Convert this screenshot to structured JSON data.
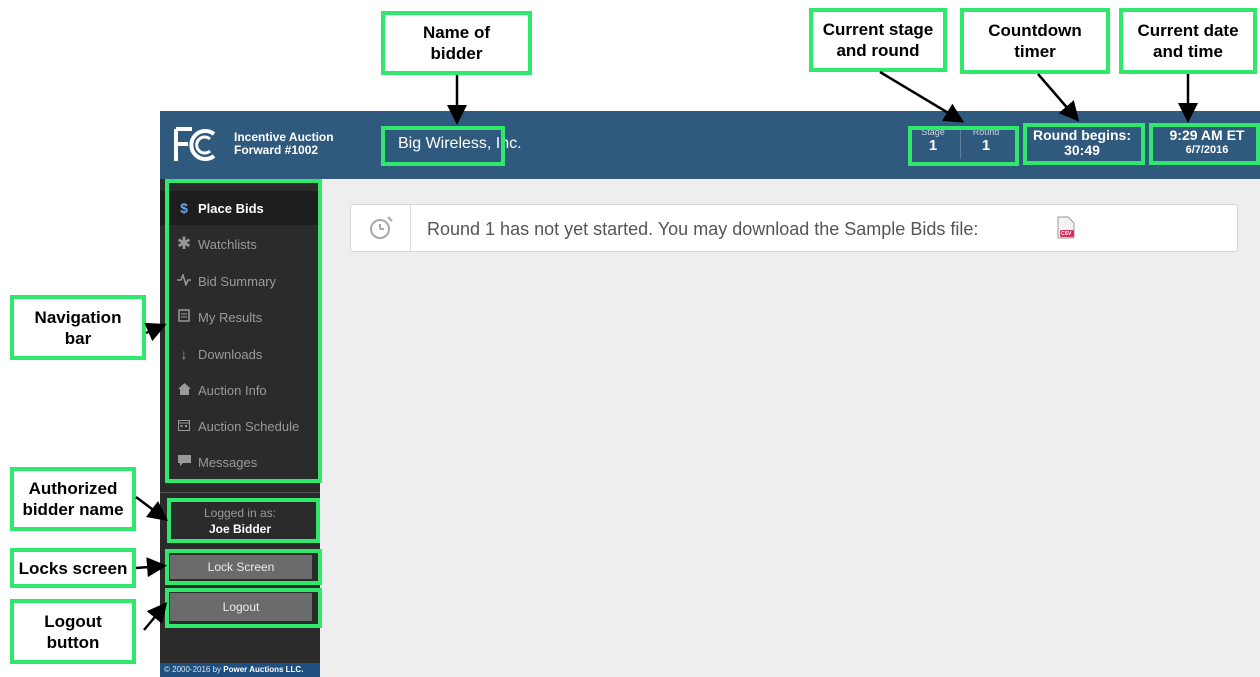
{
  "header": {
    "app_title_line1": "Incentive Auction",
    "app_title_line2": "Forward #1002",
    "bidder_name": "Big Wireless, Inc.",
    "stage_label": "Stage",
    "stage_value": "1",
    "round_label": "Round",
    "round_value": "1",
    "timer_label": "Round begins:",
    "timer_value": "30:49",
    "time": "9:29 AM ET",
    "date": "6/7/2016"
  },
  "sidebar": {
    "items": [
      {
        "label": "Place Bids",
        "icon": "dollar-icon"
      },
      {
        "label": "Watchlists",
        "icon": "asterisk-icon"
      },
      {
        "label": "Bid Summary",
        "icon": "pulse-icon"
      },
      {
        "label": "My Results",
        "icon": "document-icon"
      },
      {
        "label": "Downloads",
        "icon": "download-arrow-icon"
      },
      {
        "label": "Auction Info",
        "icon": "home-icon"
      },
      {
        "label": "Auction Schedule",
        "icon": "calendar-icon"
      },
      {
        "label": "Messages",
        "icon": "message-icon"
      }
    ],
    "logged_in_label": "Logged in as:",
    "logged_in_user": "Joe Bidder",
    "lock_label": "Lock Screen",
    "logout_label": "Logout",
    "copyright_prefix": "© 2000-2016 by ",
    "copyright_company": "Power Auctions LLC."
  },
  "notice": {
    "message": "Round 1 has not yet started.  You may download the Sample Bids file:",
    "file_badge": "CSV"
  },
  "callouts": {
    "name_of_bidder": [
      "Name of",
      "bidder"
    ],
    "stage_round": [
      "Current stage",
      "and round"
    ],
    "countdown": [
      "Countdown",
      "timer"
    ],
    "date_time": [
      "Current date",
      "and time"
    ],
    "navigation": [
      "Navigation",
      "bar"
    ],
    "authorized": [
      "Authorized",
      "bidder name"
    ],
    "locks": [
      "Locks screen"
    ],
    "logout": [
      "Logout",
      "button"
    ]
  },
  "colors": {
    "header_bg": "#2f5a7e",
    "sidebar_bg": "#2b2b2b",
    "content_bg": "#eeeeee",
    "highlight": "#2fe86c"
  }
}
